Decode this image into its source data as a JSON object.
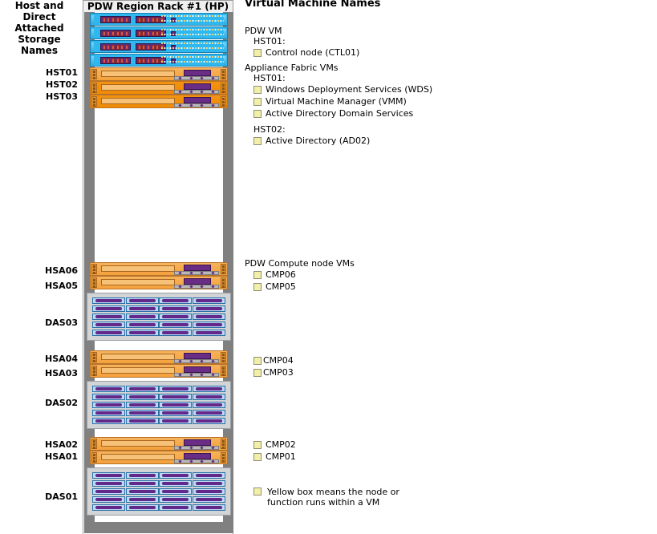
{
  "headings": {
    "left": "Host and\nDirect Attached\nStorage Names",
    "left_line1": "Host and",
    "left_line2": "Direct Attached",
    "left_line3": "Storage Names",
    "right": "Virtual Machine Names"
  },
  "rack": {
    "title": "PDW Region Rack #1 (HP)",
    "host_labels": [
      "HST01",
      "HST02",
      "HST03"
    ],
    "storage_labels": [
      "HSA06",
      "HSA05",
      "DAS03",
      "HSA04",
      "HSA03",
      "DAS02",
      "HSA02",
      "HSA01",
      "DAS01"
    ],
    "label_hst01": "HST01",
    "label_hst02": "HST02",
    "label_hst03": "HST03",
    "label_hsa06": "HSA06",
    "label_hsa05": "HSA05",
    "label_das03": "DAS03",
    "label_hsa04": "HSA04",
    "label_hsa03": "HSA03",
    "label_das02": "DAS02",
    "label_hsa02": "HSA02",
    "label_hsa01": "HSA01",
    "label_das01": "DAS01"
  },
  "legend": {
    "pdw_vm": {
      "group": "PDW VM",
      "host": "HST01:",
      "items": [
        "Control node (CTL01)"
      ]
    },
    "fabric": {
      "group": "Appliance Fabric VMs",
      "host1": "HST01:",
      "items1": [
        "Windows Deployment Services (WDS)",
        "Virtual Machine Manager (VMM)",
        "Active Directory Domain Services"
      ],
      "host2": "HST02:",
      "items2": [
        "Active Directory (AD02)"
      ]
    },
    "compute": {
      "group": "PDW Compute node VMs",
      "top": [
        "CMP06",
        "CMP05"
      ],
      "mid": [
        "CMP04",
        "CMP03"
      ],
      "low": [
        "CMP02",
        "CMP01"
      ]
    },
    "key": {
      "line1": "Yellow box means the node or",
      "line2": "function runs within a VM"
    }
  },
  "colors": {
    "vm_box": "#f2f0a8",
    "switch": "#2fb8ef",
    "server": "#f4a13c",
    "server_dark": "#ef8b06",
    "rail": "#808080",
    "enclosure": "#d2d4d6",
    "drive": "#bcd9f2",
    "drive_handle": "#63288a"
  }
}
